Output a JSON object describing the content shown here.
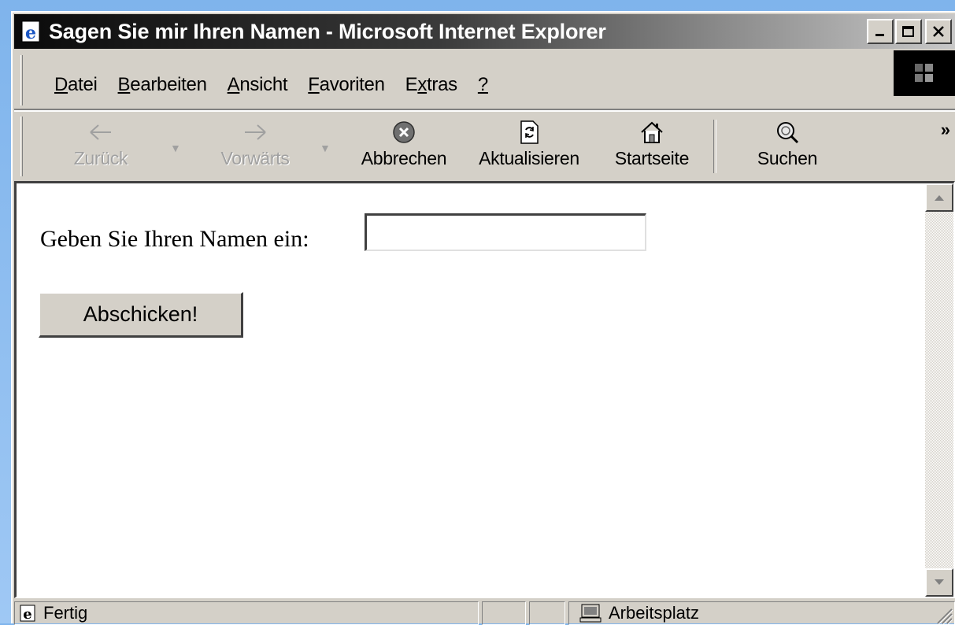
{
  "window": {
    "title": "Sagen Sie mir Ihren Namen - Microsoft Internet Explorer",
    "controls": {
      "minimize": "_",
      "maximize": "□",
      "close": "×"
    }
  },
  "menu": {
    "items": [
      {
        "label": "Datei",
        "accel": "D",
        "rest": "atei"
      },
      {
        "label": "Bearbeiten",
        "accel": "B",
        "rest": "earbeiten"
      },
      {
        "label": "Ansicht",
        "accel": "A",
        "rest": "nsicht"
      },
      {
        "label": "Favoriten",
        "accel": "F",
        "rest": "avoriten"
      },
      {
        "label": "Extras",
        "pre": "E",
        "accel": "x",
        "rest": "tras"
      },
      {
        "label": "?",
        "accel": "?",
        "rest": ""
      }
    ]
  },
  "toolbar": {
    "back": {
      "label": "Zurück",
      "icon": "back-arrow-icon",
      "enabled": false
    },
    "forward": {
      "label": "Vorwärts",
      "icon": "forward-arrow-icon",
      "enabled": false
    },
    "stop": {
      "label": "Abbrechen",
      "icon": "stop-icon"
    },
    "refresh": {
      "label": "Aktualisieren",
      "icon": "refresh-icon"
    },
    "home": {
      "label": "Startseite",
      "icon": "home-icon"
    },
    "search": {
      "label": "Suchen",
      "icon": "search-icon"
    },
    "more": "»"
  },
  "page": {
    "prompt": "Geben Sie Ihren Namen ein:",
    "name_value": "",
    "submit_label": "Abschicken!"
  },
  "status": {
    "text": "Fertig",
    "zone": "Arbeitsplatz"
  }
}
